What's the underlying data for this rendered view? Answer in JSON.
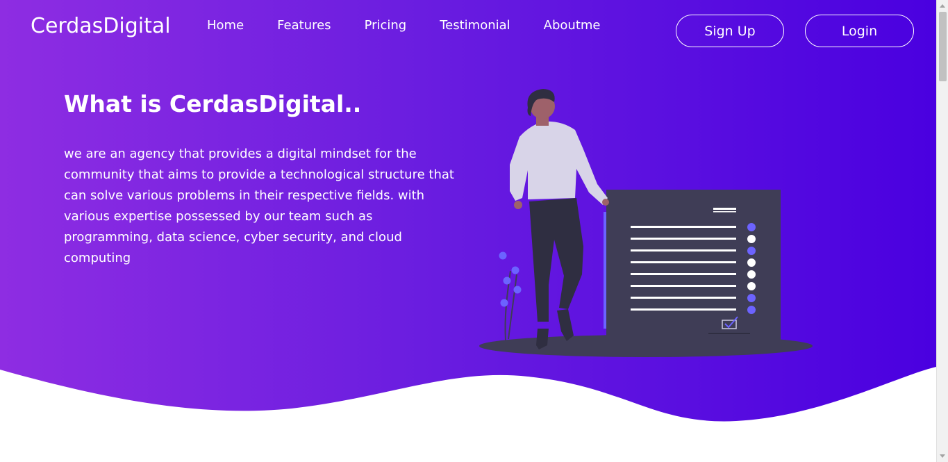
{
  "brand": "CerdasDigital",
  "nav": {
    "items": [
      "Home",
      "Features",
      "Pricing",
      "Testimonial",
      "Aboutme"
    ]
  },
  "auth": {
    "signup_label": "Sign Up",
    "login_label": "Login"
  },
  "hero": {
    "title": "What is CerdasDigital..",
    "description": "we are an agency that provides a digital mindset for the community that aims to provide a technological structure that can solve various problems in their respective fields. with various expertise possessed by our team such as programming, data science, cyber security, and cloud computing"
  },
  "colors": {
    "gradient_start": "#8e2de2",
    "gradient_end": "#4a00e0",
    "accent": "#6c63ff",
    "board": "#3f3d56"
  },
  "illustration": "person-with-checklist-board"
}
